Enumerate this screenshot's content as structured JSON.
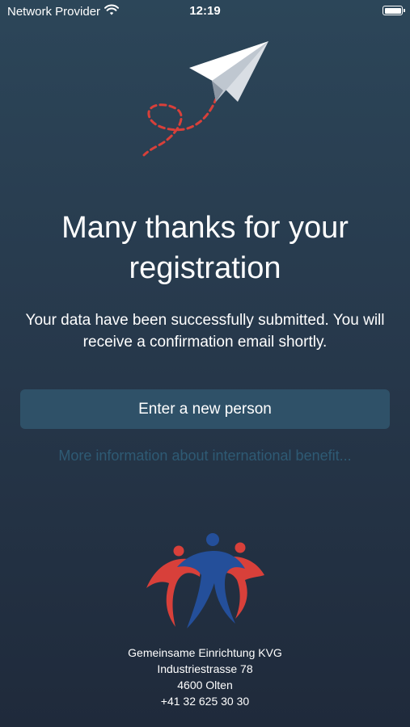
{
  "status_bar": {
    "carrier": "Network Provider",
    "time": "12:19",
    "wifi_icon": "wifi-icon",
    "battery_icon": "battery-icon",
    "battery_level": 1.0
  },
  "illustration": {
    "icon": "paper-plane-icon",
    "plane_color": "#ffffff",
    "trail_color": "#d8403a"
  },
  "confirmation": {
    "title": "Many thanks for your registration",
    "message": "Your data have been successfully submitted. You will receive a confirmation email shortly."
  },
  "actions": {
    "new_person_label": "Enter a new person",
    "info_link_label": "More information about international benefit..."
  },
  "footer": {
    "logo_icon": "kvg-logo-icon",
    "organization": "Gemeinsame Einrichtung KVG",
    "street": "Industriestrasse 78",
    "city": "4600 Olten",
    "phone": "+41 32 625 30 30"
  },
  "colors": {
    "background_top": "#2c4659",
    "background_bottom": "#1f2a3b",
    "button": "#2f5168",
    "link": "#2e5a74",
    "logo_red": "#d8403a",
    "logo_blue": "#244f9a"
  }
}
